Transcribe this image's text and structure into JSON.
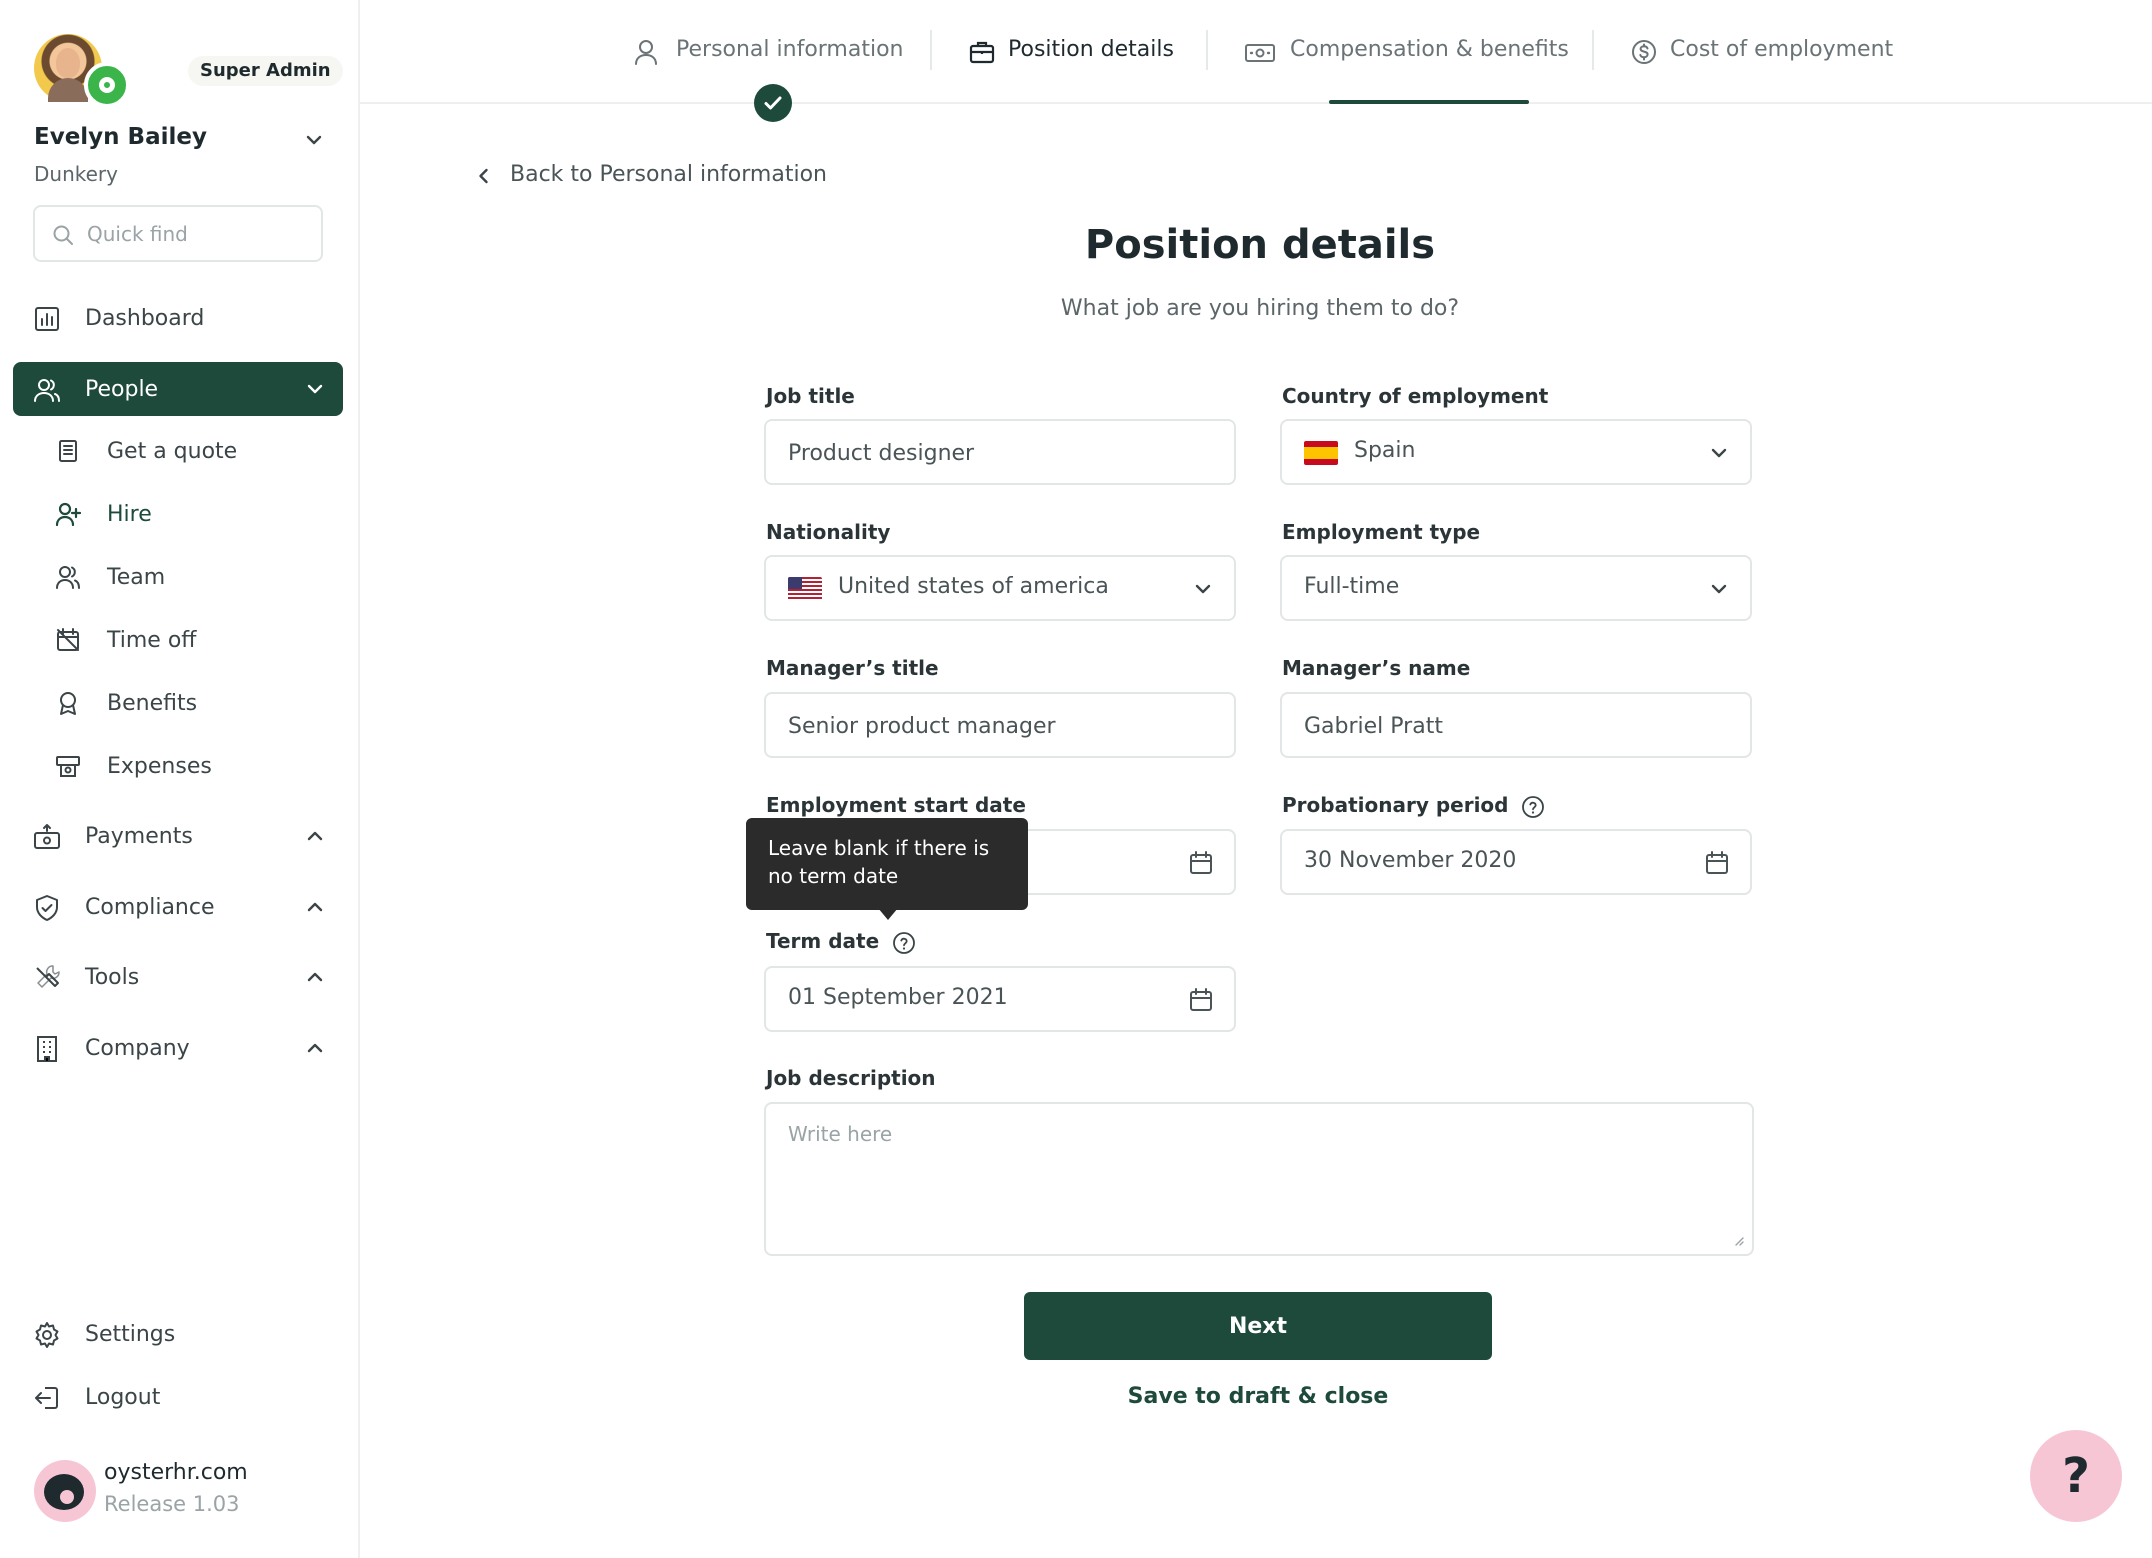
{
  "user": {
    "role_badge": "Super Admin",
    "name": "Evelyn Bailey",
    "company": "Dunkery"
  },
  "search": {
    "placeholder": "Quick find"
  },
  "sidebar": {
    "items": [
      {
        "label": "Dashboard",
        "icon": "dashboard-icon"
      },
      {
        "label": "People",
        "icon": "people-icon",
        "active": true
      },
      {
        "label": "Payments",
        "icon": "payments-icon"
      },
      {
        "label": "Compliance",
        "icon": "shield-icon"
      },
      {
        "label": "Tools",
        "icon": "tools-icon"
      },
      {
        "label": "Company",
        "icon": "building-icon"
      }
    ],
    "people_sub": [
      {
        "label": "Get a quote",
        "icon": "quote-icon"
      },
      {
        "label": "Hire",
        "icon": "add-user-icon",
        "current": true
      },
      {
        "label": "Team",
        "icon": "team-icon"
      },
      {
        "label": "Time off",
        "icon": "calendar-off-icon"
      },
      {
        "label": "Benefits",
        "icon": "award-icon"
      },
      {
        "label": "Expenses",
        "icon": "receipt-icon"
      }
    ],
    "footer": [
      {
        "label": "Settings",
        "icon": "gear-icon"
      },
      {
        "label": "Logout",
        "icon": "logout-icon"
      }
    ],
    "brand": {
      "name": "oysterhr.com",
      "release": "Release 1.03"
    }
  },
  "tabs": [
    {
      "label": "Personal information",
      "icon": "user-icon",
      "completed": true
    },
    {
      "label": "Position details",
      "icon": "briefcase-icon",
      "active": true
    },
    {
      "label": "Compensation & benefits",
      "icon": "cash-icon"
    },
    {
      "label": "Cost of employment",
      "icon": "dollar-circle-icon"
    }
  ],
  "main": {
    "back_label": "Back to Personal information",
    "title": "Position details",
    "subtitle": "What job are you hiring them to do?",
    "fields": {
      "job_title": {
        "label": "Job title",
        "value": "Product designer"
      },
      "country": {
        "label": "Country of employment",
        "value": "Spain"
      },
      "nationality": {
        "label": "Nationality",
        "value": "United states of america"
      },
      "employment_type": {
        "label": "Employment type",
        "value": "Full-time"
      },
      "manager_title": {
        "label": "Manager’s title",
        "value": "Senior product manager"
      },
      "manager_name": {
        "label": "Manager’s name",
        "value": "Gabriel Pratt"
      },
      "start_date": {
        "label": "Employment start date",
        "value": ""
      },
      "probation": {
        "label": "Probationary period",
        "value": "30 November 2020"
      },
      "term_date": {
        "label": "Term date",
        "value": "01 September 2021"
      },
      "job_description": {
        "label": "Job description",
        "placeholder": "Write here"
      }
    },
    "tooltip": "Leave blank if there is no term date",
    "next_label": "Next",
    "draft_label": "Save to draft & close"
  },
  "help_fab": "?",
  "colors": {
    "brand_green": "#1d4a3b",
    "success_green": "#3bb54a",
    "accent_pink": "#f7c6d4"
  }
}
